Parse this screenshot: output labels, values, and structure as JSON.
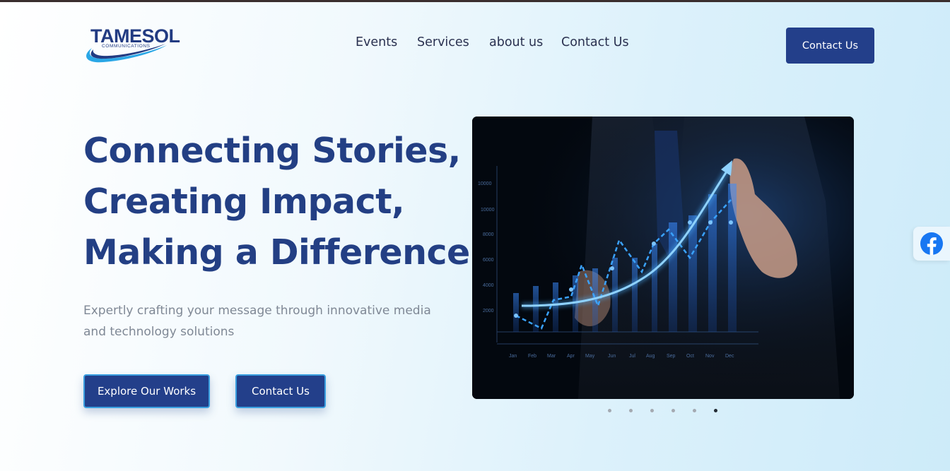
{
  "brand": {
    "name": "TAMESOL",
    "tagline": "COMMUNICATIONS",
    "colors": {
      "primary": "#233f8a",
      "accent": "#3a9fe0",
      "heading": "#233f84"
    }
  },
  "nav": {
    "items": [
      "Events",
      "Services",
      "about us",
      "Contact Us"
    ]
  },
  "header": {
    "cta_label": "Contact Us"
  },
  "hero": {
    "title_lines": [
      "Connecting Stories,",
      "Creating Impact,",
      "Making a Difference"
    ],
    "subtitle": "Expertly crafting your message through innovative media and technology solutions",
    "buttons": {
      "explore": "Explore Our Works",
      "contact": "Contact Us"
    }
  },
  "slider": {
    "image_icon": "business-growth-chart-image",
    "chart_axis_labels": {
      "y": [
        "10000",
        "10000",
        "8000",
        "6000",
        "4000",
        "2000"
      ],
      "x": [
        "Jan",
        "Feb",
        "Mar",
        "Apr",
        "May",
        "Jun",
        "Jul",
        "Aug",
        "Sep",
        "Oct",
        "Nov",
        "Dec"
      ]
    },
    "slide_count": 6,
    "active_slide": 6
  },
  "social": {
    "facebook_icon": "facebook-icon",
    "facebook_color": "#1877f2"
  }
}
